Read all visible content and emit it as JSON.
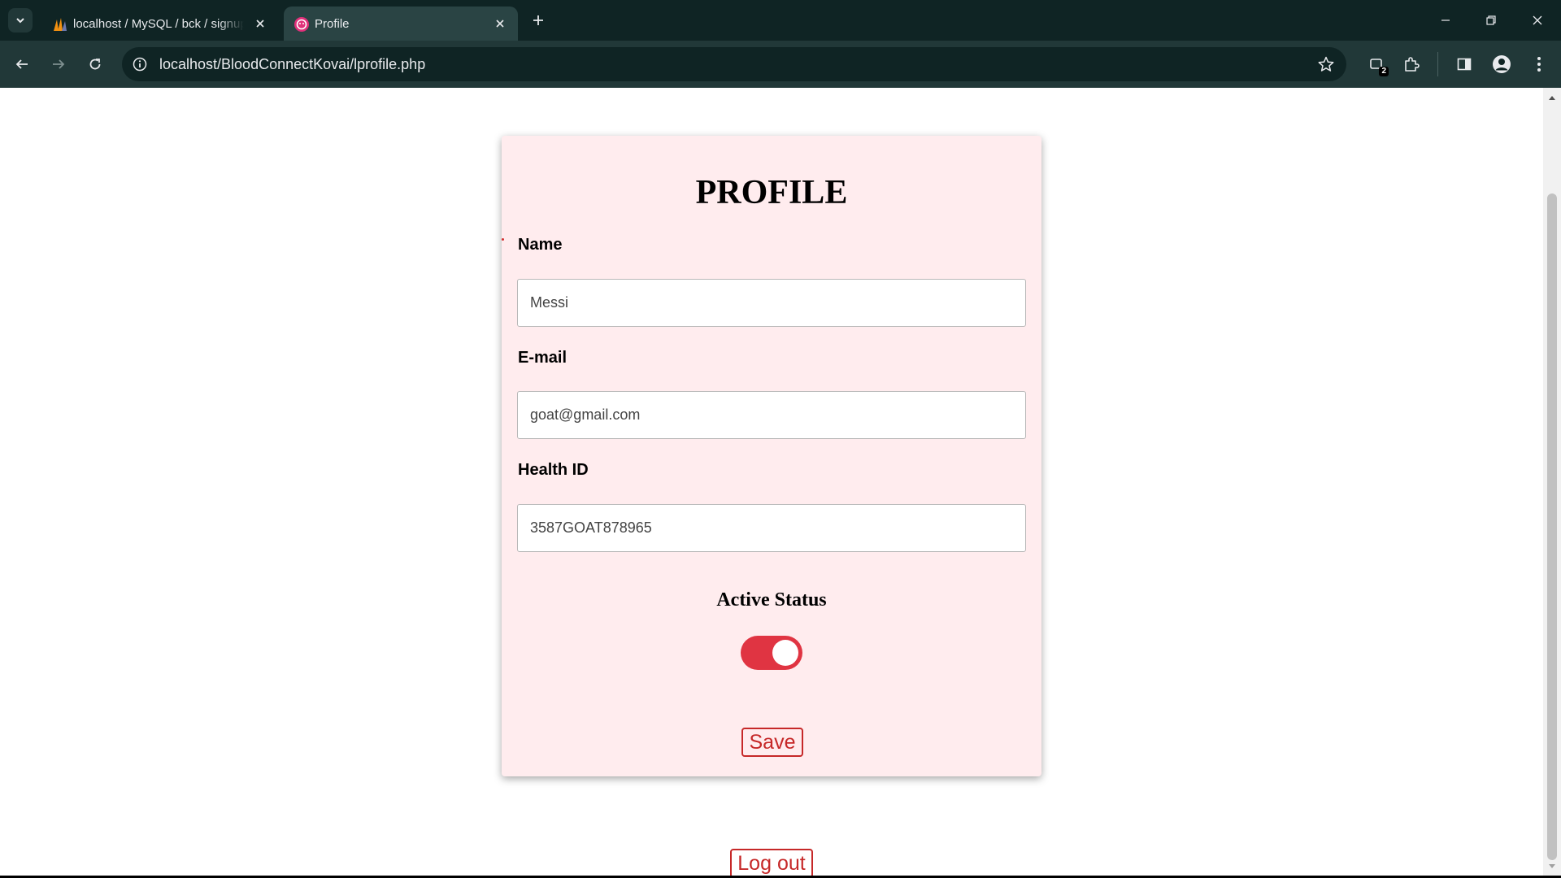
{
  "browser": {
    "tabs": [
      {
        "title": "localhost / MySQL / bck / signup",
        "icon": "phpmyadmin-icon",
        "active": false
      },
      {
        "title": "Profile",
        "icon": "profile-favicon",
        "active": true
      }
    ],
    "url": "localhost/BloodConnectKovai/lprofile.php",
    "extensions_badge": "2"
  },
  "page": {
    "title": "PROFILE",
    "fields": {
      "name": {
        "label": "Name",
        "value": "Messi"
      },
      "email": {
        "label": "E-mail",
        "value": "goat@gmail.com"
      },
      "health_id": {
        "label": "Health ID",
        "value": "3587GOAT878965"
      }
    },
    "active_status": {
      "label": "Active Status",
      "on": true
    },
    "save_label": "Save",
    "logout_label": "Log out"
  },
  "colors": {
    "card_bg": "#ffecee",
    "accent": "#e03442",
    "button_text": "#c62828",
    "chrome_dark": "#0f2424",
    "chrome_toolbar": "#213838"
  }
}
